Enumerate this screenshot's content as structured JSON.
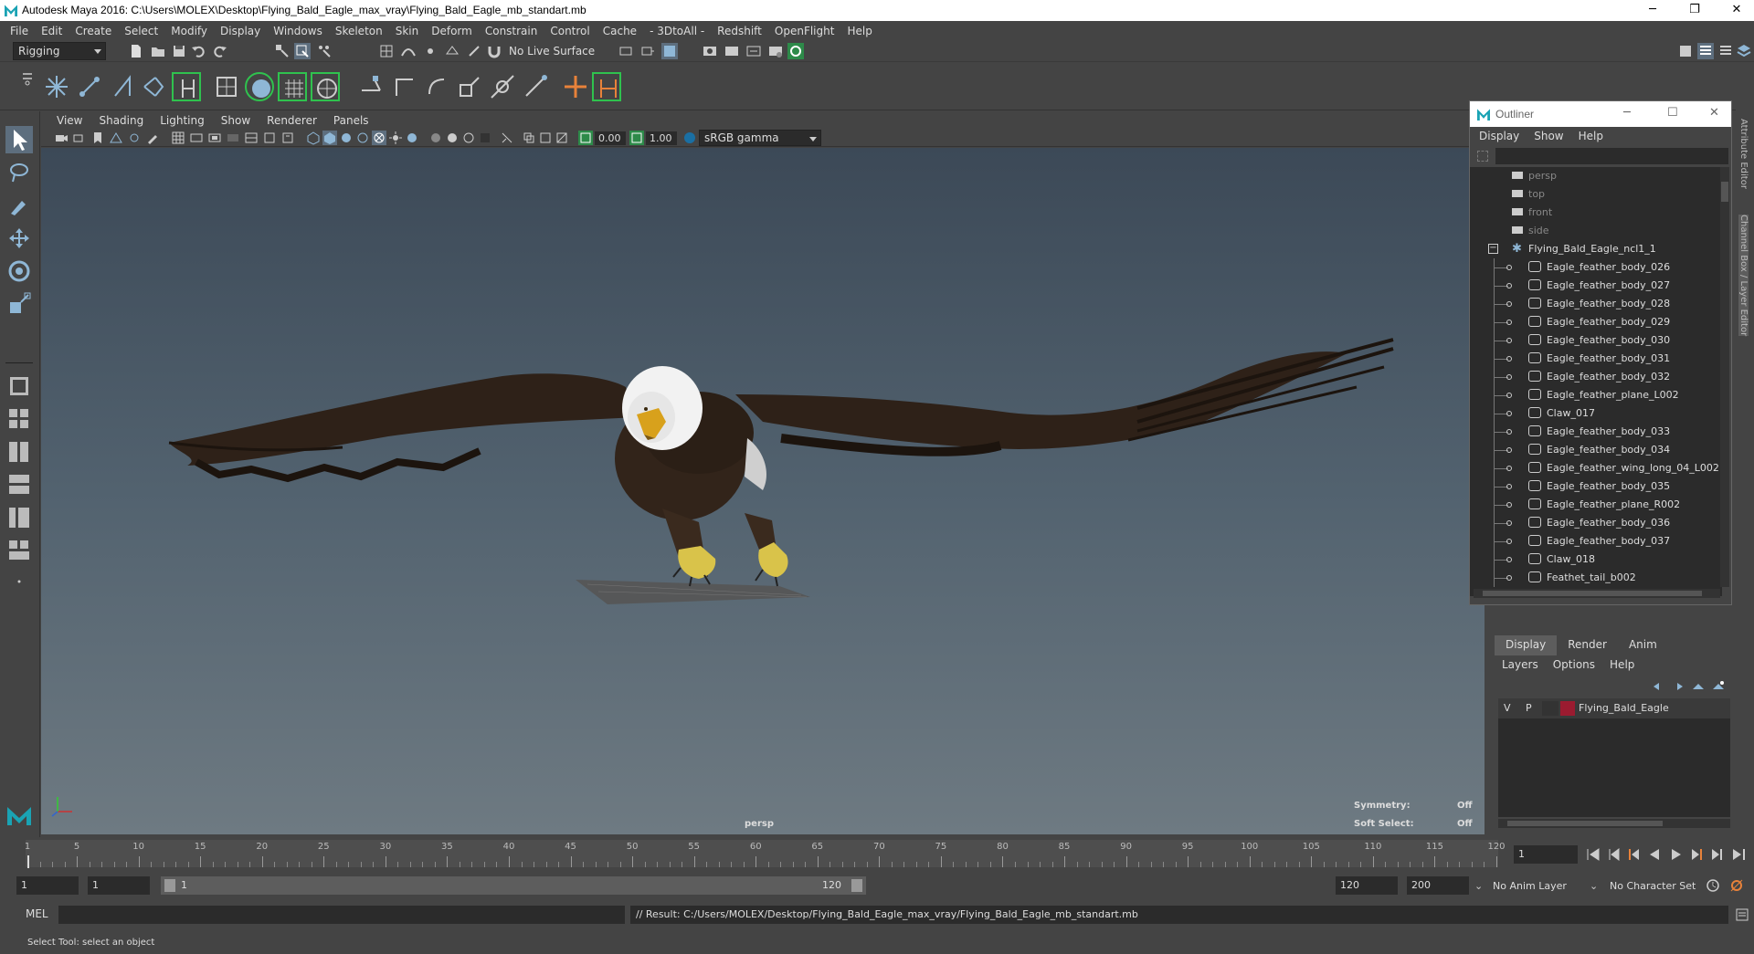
{
  "window": {
    "title": "Autodesk Maya 2016: C:\\Users\\MOLEX\\Desktop\\Flying_Bald_Eagle_max_vray\\Flying_Bald_Eagle_mb_standart.mb",
    "minimize": "─",
    "restore": "❐",
    "close": "✕"
  },
  "menubar": [
    "File",
    "Edit",
    "Create",
    "Select",
    "Modify",
    "Display",
    "Windows",
    "Skeleton",
    "Skin",
    "Deform",
    "Constrain",
    "Control",
    "Cache",
    "- 3DtoAll -",
    "Redshift",
    "OpenFlight",
    "Help"
  ],
  "statusline": {
    "menuset": "Rigging",
    "live_surface": "No Live Surface"
  },
  "viewport": {
    "menu": [
      "View",
      "Shading",
      "Lighting",
      "Show",
      "Renderer",
      "Panels"
    ],
    "exposure": "0.00",
    "gamma": "1.00",
    "colorspace": "sRGB gamma",
    "camera_label": "persp",
    "hud": {
      "symmetry_label": "Symmetry:",
      "symmetry_value": "Off",
      "soft_select_label": "Soft Select:",
      "soft_select_value": "Off"
    }
  },
  "outliner": {
    "title": "Outliner",
    "menu": [
      "Display",
      "Show",
      "Help"
    ],
    "cameras": [
      "persp",
      "top",
      "front",
      "side"
    ],
    "group": "Flying_Bald_Eagle_ncl1_1",
    "children": [
      "Eagle_feather_body_026",
      "Eagle_feather_body_027",
      "Eagle_feather_body_028",
      "Eagle_feather_body_029",
      "Eagle_feather_body_030",
      "Eagle_feather_body_031",
      "Eagle_feather_body_032",
      "Eagle_feather_plane_L002",
      "Claw_017",
      "Eagle_feather_body_033",
      "Eagle_feather_body_034",
      "Eagle_feather_wing_long_04_L002",
      "Eagle_feather_body_035",
      "Eagle_feather_plane_R002",
      "Eagle_feather_body_036",
      "Eagle_feather_body_037",
      "Claw_018",
      "Feathet_tail_b002"
    ]
  },
  "layer_editor": {
    "tabs": [
      "Display",
      "Render",
      "Anim"
    ],
    "active_tab": "Display",
    "menu": [
      "Layers",
      "Options",
      "Help"
    ],
    "layer": {
      "v": "V",
      "p": "P",
      "name": "Flying_Bald_Eagle",
      "color": "#9b1b30"
    }
  },
  "timeslider": {
    "start": 1,
    "end": 120,
    "labels": [
      1,
      5,
      10,
      15,
      20,
      25,
      30,
      35,
      40,
      45,
      50,
      55,
      60,
      65,
      70,
      75,
      80,
      85,
      90,
      95,
      100,
      105,
      110,
      115,
      120
    ],
    "current_frame": "1"
  },
  "rangeslider": {
    "start_field": "1",
    "anim_start_field": "1",
    "range_start": "1",
    "range_end": "120",
    "end_field": "120",
    "anim_end_field": "200",
    "anim_layer": "No Anim Layer",
    "character_set": "No Character Set"
  },
  "cmdline": {
    "lang": "MEL",
    "result": "// Result: C:/Users/MOLEX/Desktop/Flying_Bald_Eagle_max_vray/Flying_Bald_Eagle_mb_standart.mb"
  },
  "helpline": "Select Tool: select an object",
  "sidetabs": [
    "Attribute Editor",
    "Channel Box / Layer Editor"
  ]
}
